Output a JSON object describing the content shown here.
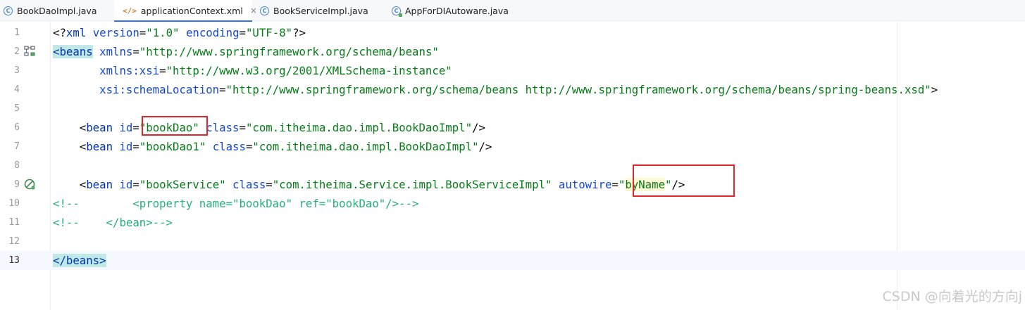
{
  "tabs": [
    {
      "label": "BookDaoImpl.java",
      "icon": "class-icon",
      "active": false
    },
    {
      "label": "applicationContext.xml",
      "icon": "xml-icon",
      "active": true,
      "close": "×"
    },
    {
      "label": "BookServiceImpl.java",
      "icon": "class-icon",
      "active": false
    },
    {
      "label": "AppForDIAutoware.java",
      "icon": "runnable-class-icon",
      "active": false
    }
  ],
  "editor": {
    "line_numbers": [
      "1",
      "2",
      "3",
      "4",
      "5",
      "6",
      "7",
      "8",
      "9",
      "10",
      "11",
      "12",
      "13"
    ],
    "current_line": "13",
    "gutter_icons": {
      "line_2": "spring-bean-structure-icon",
      "line_9": "spring-bean-gutter-icon"
    },
    "tokens": {
      "l1": {
        "a": "<?",
        "b": "xml",
        "c": " ",
        "d": "version",
        "e": "=",
        "f": "\"1.0\"",
        "g": " ",
        "h": "encoding",
        "i": "=",
        "j": "\"UTF-8\"",
        "k": "?>"
      },
      "l2": {
        "a": "<",
        "b": "beans",
        "c": " ",
        "d": "xmlns",
        "e": "=",
        "f": "\"http://www.springframework.org/schema/beans\""
      },
      "l3": {
        "ind": "       ",
        "a": "xmlns:xsi",
        "b": "=",
        "c": "\"http://www.w3.org/2001/XMLSchema-instance\""
      },
      "l4": {
        "ind": "       ",
        "a": "xsi:schemaLocation",
        "b": "=",
        "c": "\"http://www.springframework.org/schema/beans http://www.springframework.org/schema/beans/spring-beans.xsd\"",
        "d": ">"
      },
      "l6": {
        "ind": "    ",
        "a": "<",
        "b": "bean",
        "c": " ",
        "d": "id",
        "e": "=",
        "f": "\"bookDao\"",
        "g": " ",
        "h": "class",
        "i": "=",
        "j": "\"com.itheima.dao.impl.BookDaoImpl\"",
        "k": "/>"
      },
      "l7": {
        "ind": "    ",
        "a": "<",
        "b": "bean",
        "c": " ",
        "d": "id",
        "e": "=",
        "f": "\"bookDao1\"",
        "g": " ",
        "h": "class",
        "i": "=",
        "j": "\"com.itheima.dao.impl.BookDaoImpl\"",
        "k": "/>"
      },
      "l9": {
        "ind": "    ",
        "a": "<",
        "b": "bean",
        "c": " ",
        "d": "id",
        "e": "=",
        "f": "\"bookService\"",
        "g": " ",
        "h": "class",
        "i": "=",
        "j": "\"com.itheima.Service.impl.BookServiceImpl\"",
        "k": " ",
        "l": "autowire",
        "m": "=",
        "n": "\"",
        "o": "byName",
        "p": "\"",
        "q": "/>"
      },
      "l10": {
        "a": "<!--        <property name=\"bookDao\" ref=\"bookDao\"/>-->"
      },
      "l11": {
        "a": "<!--    </bean>-->"
      },
      "l13": {
        "a": "</",
        "b": "beans",
        "c": ">"
      }
    }
  },
  "colors": {
    "tag": "#0033b3",
    "attribute": "#174ad4",
    "string": "#067d17",
    "comment": "#23b07c",
    "annotation_box": "#e0262b",
    "active_tab_underline": "#3574f0"
  },
  "watermark": "CSDN @向着光的方向j"
}
